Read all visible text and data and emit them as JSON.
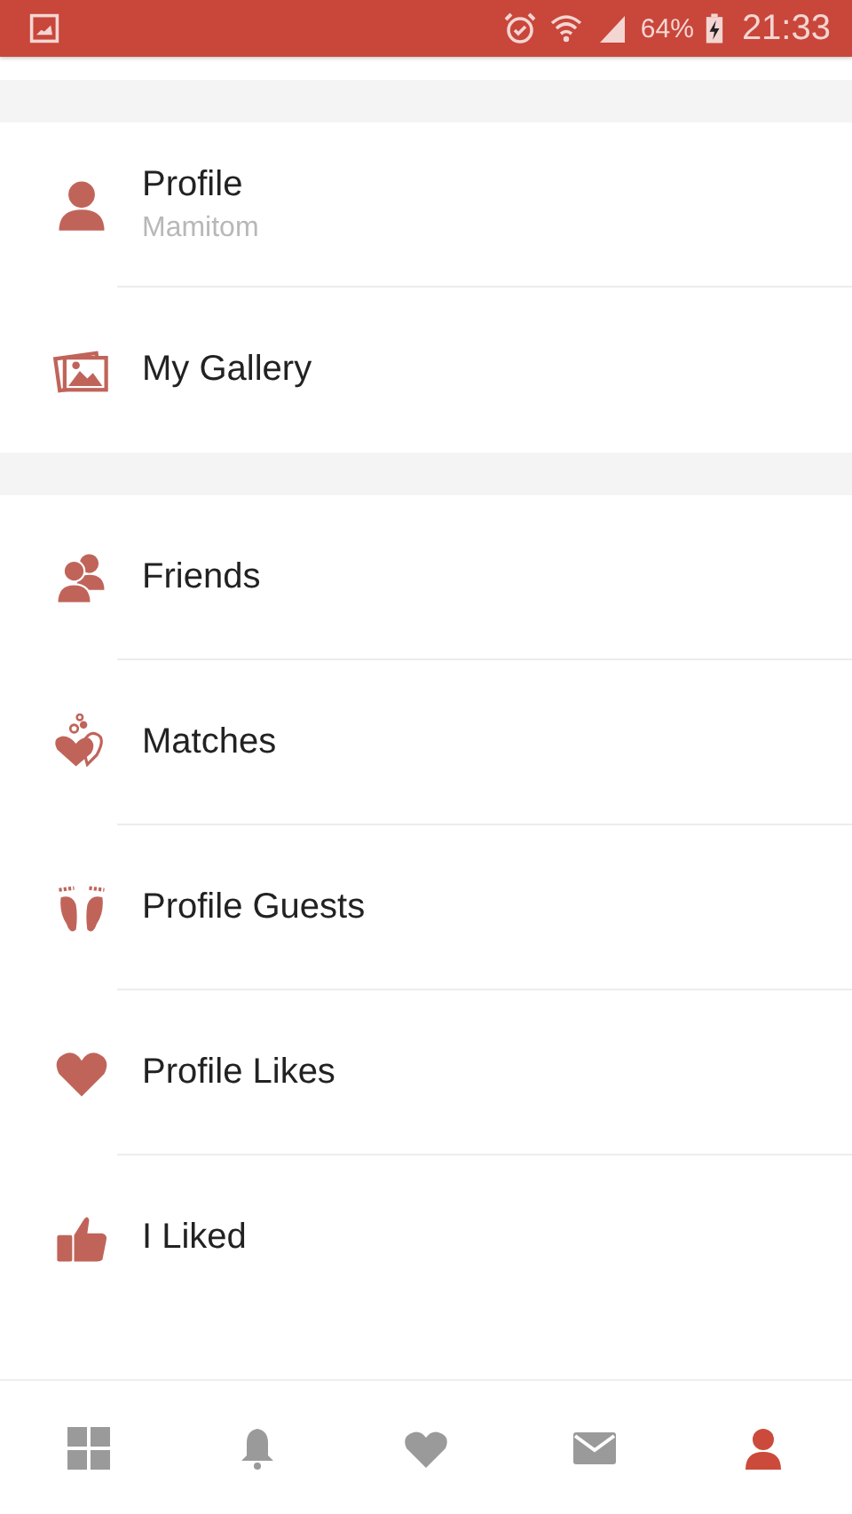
{
  "status_bar": {
    "battery": "64%",
    "time": "21:33"
  },
  "sections": [
    {
      "items": [
        {
          "label": "Profile",
          "sublabel": "Mamitom"
        },
        {
          "label": "My Gallery"
        }
      ]
    },
    {
      "items": [
        {
          "label": "Friends"
        },
        {
          "label": "Matches"
        },
        {
          "label": "Profile Guests"
        },
        {
          "label": "Profile Likes"
        },
        {
          "label": "I Liked"
        }
      ]
    }
  ],
  "bottom_nav": [
    {
      "selected": false
    },
    {
      "selected": false
    },
    {
      "selected": false
    },
    {
      "selected": false
    },
    {
      "selected": true
    }
  ]
}
